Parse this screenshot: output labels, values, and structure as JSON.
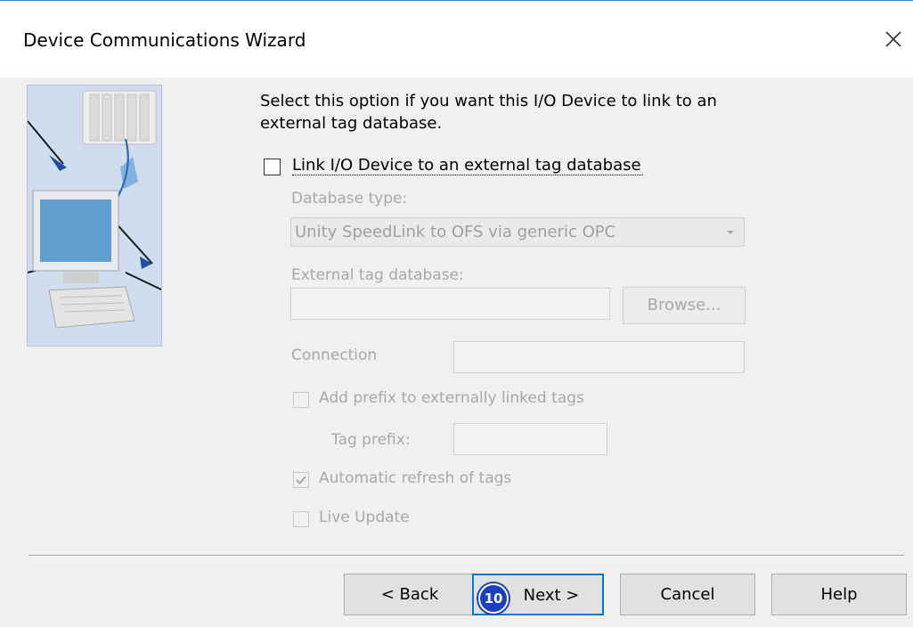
{
  "window": {
    "title": "Device Communications Wizard"
  },
  "description": "Select this option if you want this I/O Device to link to an external tag database.",
  "link_checkbox": {
    "label": "Link I/O Device to an external tag database",
    "checked": false
  },
  "database_type": {
    "label": "Database type:",
    "value": "Unity SpeedLink to OFS via generic OPC"
  },
  "external_db": {
    "label": "External tag database:",
    "value": "",
    "browse_label": "Browse..."
  },
  "connection": {
    "label": "Connection",
    "value": ""
  },
  "prefix_checkbox": {
    "label": "Add prefix to externally linked tags",
    "checked": false
  },
  "tag_prefix": {
    "label": "Tag prefix:",
    "value": ""
  },
  "auto_refresh": {
    "label": "Automatic refresh of tags",
    "checked": true
  },
  "live_update": {
    "label": "Live Update",
    "checked": false
  },
  "buttons": {
    "back": "< Back",
    "next": "Next >",
    "cancel": "Cancel",
    "help": "Help"
  },
  "step_badge": "10",
  "icons": {
    "close": "close-icon",
    "illustration": "device-network-illustration"
  },
  "colors": {
    "accent": "#2a82da",
    "badge": "#1a3fbf",
    "disabled_text": "#a8a8a8"
  }
}
